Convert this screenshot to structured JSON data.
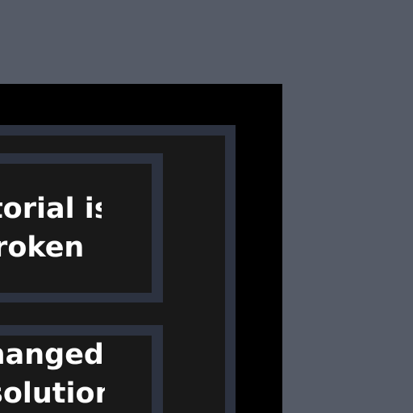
{
  "cards": [
    {
      "line1": "Tutorial is",
      "line2": "broken"
    },
    {
      "line1": "Changed",
      "line2": "resolution"
    }
  ],
  "colors": {
    "background": "#555b67",
    "frame": "#000000",
    "panel_border": "#2c3240",
    "panel_fill": "#191919",
    "text": "#ffffff"
  }
}
